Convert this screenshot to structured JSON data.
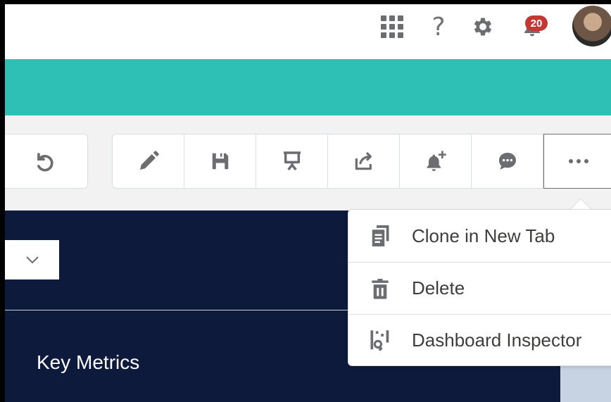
{
  "header": {
    "notification_count": "20"
  },
  "toolbar": {
    "buttons": [
      "undo",
      "edit",
      "save",
      "present",
      "share",
      "subscribe",
      "comment",
      "more"
    ]
  },
  "dashboard": {
    "section_title": "Key Metrics"
  },
  "menu": {
    "items": [
      {
        "label": "Clone in New Tab",
        "icon": "clone-icon"
      },
      {
        "label": "Delete",
        "icon": "trash-icon"
      },
      {
        "label": "Dashboard Inspector",
        "icon": "inspector-icon"
      }
    ]
  },
  "colors": {
    "teal_band": "#2ebfb5",
    "dashboard_bg": "#0e1a3b",
    "badge": "#c23934",
    "icon_gray": "#6b6d70"
  }
}
